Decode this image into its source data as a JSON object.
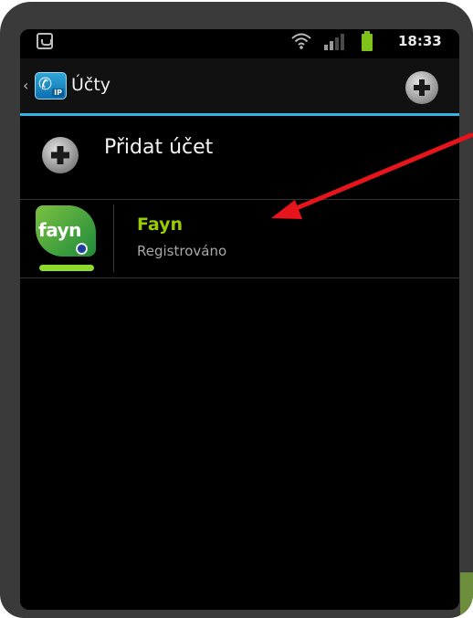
{
  "status_bar": {
    "time": "18:33",
    "icons": [
      "app-notification-icon",
      "wifi-icon",
      "signal-icon",
      "battery-icon"
    ]
  },
  "action_bar": {
    "title": "Účty",
    "app_icon_badge": "IP",
    "icons": [
      "back-caret-icon",
      "app-logo-icon",
      "add-icon"
    ]
  },
  "accounts_list": {
    "add_account_label": "Přidat účet",
    "accounts": [
      {
        "logo_text": "fayn",
        "name": "Fayn",
        "status": "Registrováno"
      }
    ]
  },
  "colors": {
    "accent": "#33b5e5",
    "account_name": "#99cc00",
    "registered_indicator": "#8ddc2c",
    "annotation_arrow": "#e8141b"
  }
}
